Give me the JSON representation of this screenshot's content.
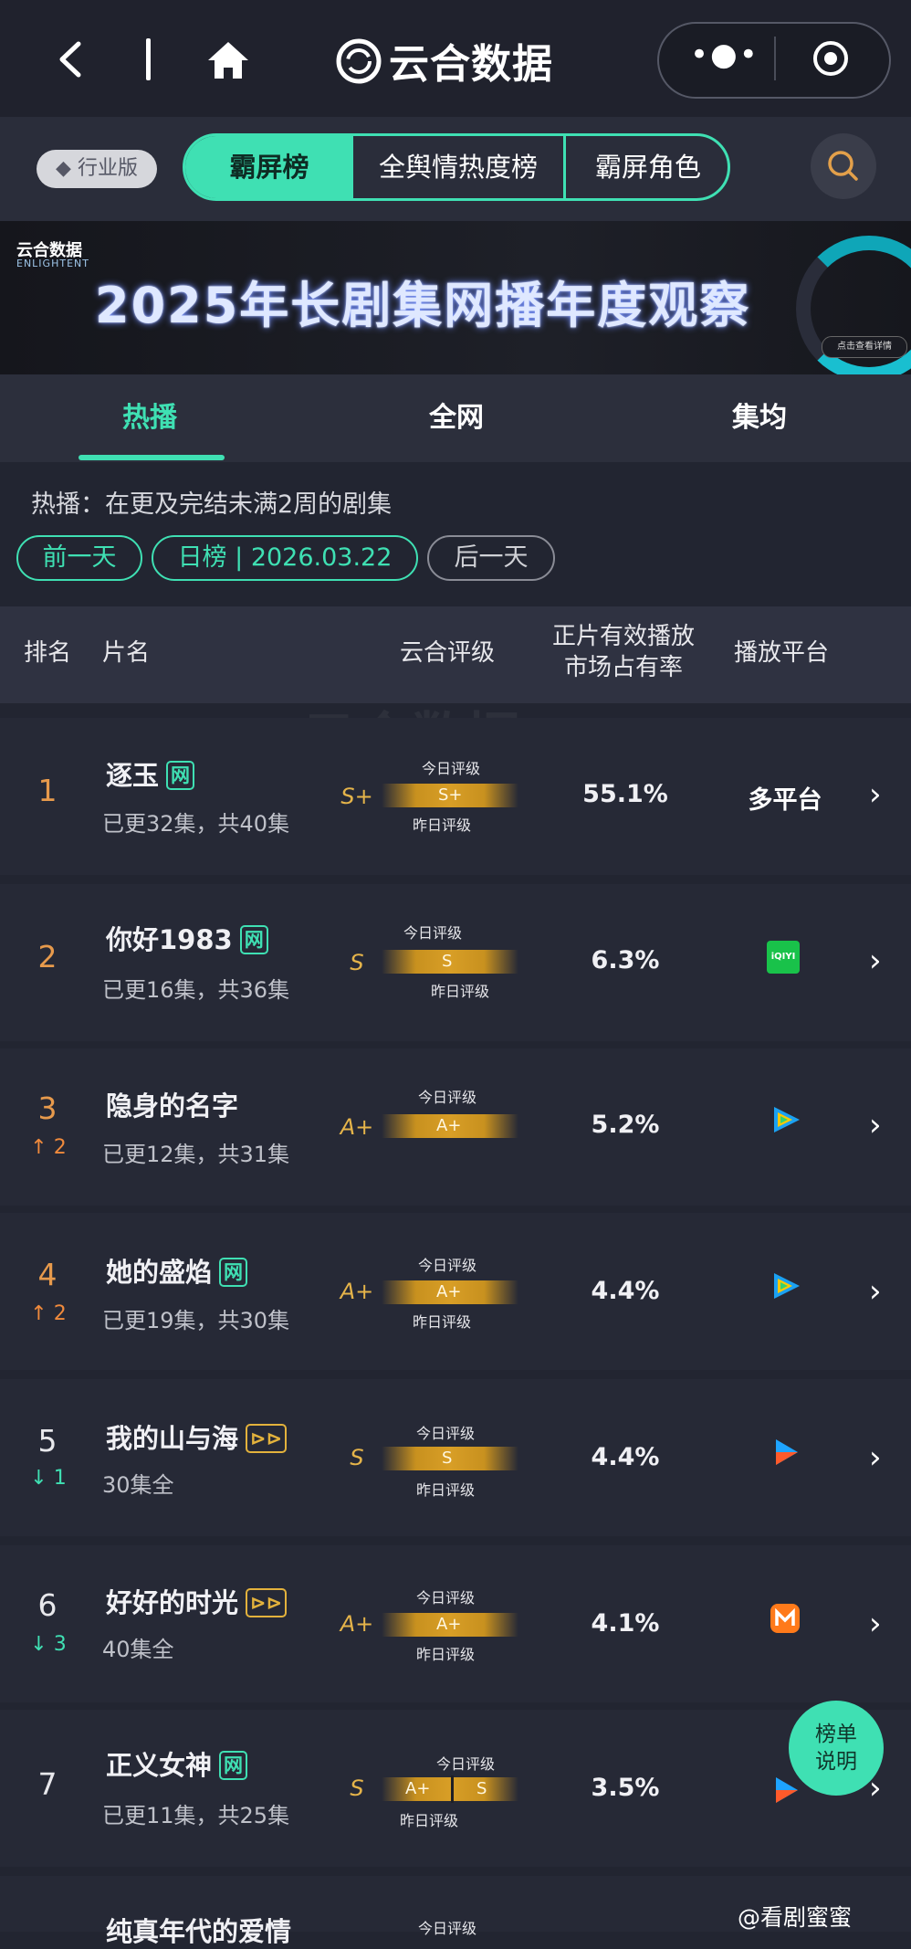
{
  "topbar": {
    "title": "云合数据",
    "back_icon": "back-arrow-icon",
    "home_icon": "home-icon"
  },
  "nav": {
    "industry_label": "行业版",
    "segments": [
      "霸屏榜",
      "全舆情热度榜",
      "霸屏角色"
    ]
  },
  "banner": {
    "brand": "云合数据",
    "brand_sub": "ENLIGHTENT",
    "title": "2025年长剧集网播年度观察",
    "cta": "点击查看详情"
  },
  "tabs": [
    "热播",
    "全网",
    "集均"
  ],
  "note": "热播：在更及完结未满2周的剧集",
  "date_pills": {
    "prev": "前一天",
    "current": "日榜 | 2026.03.22",
    "next": "后一天"
  },
  "table": {
    "headers": {
      "rank": "排名",
      "name": "片名",
      "grade": "云合评级",
      "share_line1": "正片有效播放",
      "share_line2": "市场占有率",
      "platform": "播放平台"
    },
    "today_label": "今日评级",
    "yesterday_label": "昨日评级",
    "rows": [
      {
        "rank": "1",
        "trend": "",
        "title": "逐玉",
        "tag": "网",
        "episodes": "已更32集，共40集",
        "grade": "S+",
        "bar": "S+",
        "share": "55.1%",
        "platform": "多平台"
      },
      {
        "rank": "2",
        "trend": "",
        "title": "你好1983",
        "tag": "网",
        "episodes": "已更16集，共36集",
        "grade": "S",
        "bar": "S",
        "share": "6.3%",
        "platform": "iQIYI"
      },
      {
        "rank": "3",
        "trend": "↑ 2",
        "title": "隐身的名字",
        "tag": "",
        "episodes": "已更12集，共31集",
        "grade": "A+",
        "bar": "A+",
        "share": "5.2%",
        "platform": "tencent-video-icon"
      },
      {
        "rank": "4",
        "trend": "↑ 2",
        "title": "她的盛焰",
        "tag": "网",
        "episodes": "已更19集，共30集",
        "grade": "A+",
        "bar": "A+",
        "share": "4.4%",
        "platform": "tencent-video-icon"
      },
      {
        "rank": "5",
        "trend": "↓ 1",
        "title": "我的山与海",
        "tag": "play",
        "episodes": "30集全",
        "grade": "S",
        "bar": "S",
        "share": "4.4%",
        "platform": "youku-icon"
      },
      {
        "rank": "6",
        "trend": "↓ 3",
        "title": "好好的时光",
        "tag": "play",
        "episodes": "40集全",
        "grade": "A+",
        "bar": "A+",
        "share": "4.1%",
        "platform": "mgtv-icon"
      },
      {
        "rank": "7",
        "trend": "",
        "title": "正义女神",
        "tag": "网",
        "episodes": "已更11集，共25集",
        "grade": "S",
        "bar_left": "A+",
        "bar_right": "S",
        "share": "3.5%",
        "platform": "youku-icon"
      },
      {
        "rank": "",
        "trend": "",
        "title": "纯真年代的爱情",
        "tag": "",
        "episodes": "",
        "grade": "",
        "bar": "",
        "share": "",
        "platform": ""
      }
    ]
  },
  "help_button": {
    "line1": "榜单",
    "line2": "说明"
  },
  "watermark": "@看剧蜜蜜",
  "colors": {
    "accent": "#3fe0b3",
    "gold": "#e5b44a",
    "background": "#222531"
  }
}
